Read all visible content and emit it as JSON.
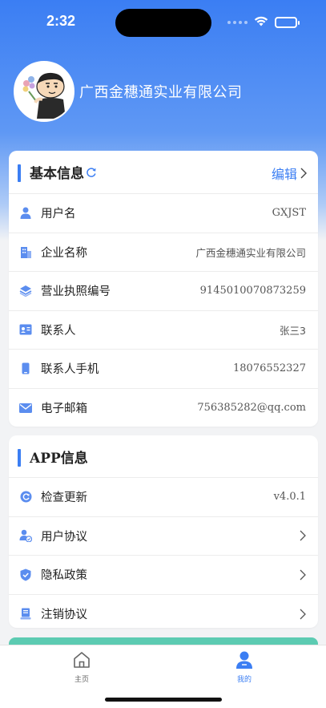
{
  "status_bar": {
    "time": "2:32"
  },
  "profile": {
    "company_name": "广西金穗通实业有限公司"
  },
  "basic_info": {
    "title": "基本信息",
    "edit_label": "编辑",
    "rows": [
      {
        "label": "用户名",
        "value": "GXJST",
        "icon": "user-icon"
      },
      {
        "label": "企业名称",
        "value": "广西金穗通实业有限公司",
        "icon": "building-icon"
      },
      {
        "label": "营业执照编号",
        "value": "9145010070873259",
        "icon": "layers-icon"
      },
      {
        "label": "联系人",
        "value": "张三3",
        "icon": "contact-card-icon"
      },
      {
        "label": "联系人手机",
        "value": "18076552327",
        "icon": "phone-icon"
      },
      {
        "label": "电子邮箱",
        "value": "756385282@qq.com",
        "icon": "mail-icon"
      }
    ]
  },
  "app_info": {
    "title": "APP信息",
    "rows": [
      {
        "label": "检查更新",
        "value": "v4.0.1",
        "icon": "update-icon"
      },
      {
        "label": "用户协议",
        "icon": "user-agreement-icon"
      },
      {
        "label": "隐私政策",
        "icon": "shield-icon"
      },
      {
        "label": "注销协议",
        "icon": "cancel-document-icon"
      }
    ]
  },
  "tabbar": {
    "home_label": "主页",
    "mine_label": "我的",
    "active": "mine"
  },
  "colors": {
    "accent": "#3b7ef3",
    "teal": "#5ccbb2"
  }
}
